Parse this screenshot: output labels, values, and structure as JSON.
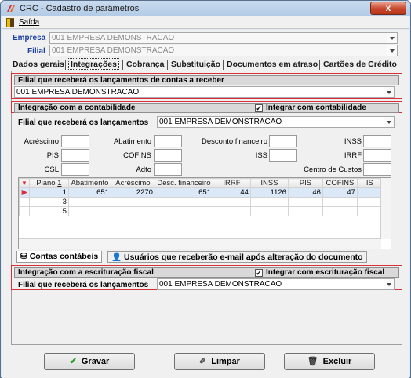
{
  "window": {
    "title": "CRC - Cadastro de parâmetros",
    "close_label": "x"
  },
  "menu": {
    "exit_label": "Saída"
  },
  "header": {
    "empresa_label": "Empresa",
    "empresa_value": "001 EMPRESA DEMONSTRACAO",
    "filial_label": "Filial",
    "filial_value": "001 EMPRESA DEMONSTRACAO"
  },
  "tabs": [
    "Dados gerais",
    "Integrações",
    "Cobrança",
    "Substituição",
    "Documentos em atraso",
    "Cartões de Crédito"
  ],
  "receivable": {
    "title": "Filial que receberá os lançamentos de contas a receber",
    "value": "001 EMPRESA DEMONSTRACAO"
  },
  "accounting": {
    "title": "Integração com a contabilidade",
    "checkbox_label": "Integrar com contabilidade",
    "checked": true,
    "filial_label": "Filial que receberá os lançamentos",
    "filial_value": "001 EMPRESA DEMONSTRACAO",
    "fields": {
      "acrescimo": "Acréscimo",
      "abatimento": "Abatimento",
      "desconto": "Desconto financeiro",
      "inss": "INSS",
      "pis": "PIS",
      "cofins": "COFINS",
      "iss": "ISS",
      "irrf": "IRRF",
      "csl": "CSL",
      "adto": "Adto",
      "centro": "Centro de Custos"
    },
    "grid": {
      "columns": [
        "Plano",
        "Abatimento",
        "Acréscimo",
        "Desc. financeiro",
        "IRRF",
        "INSS",
        "PIS",
        "COFINS",
        "IS"
      ],
      "sort_marker": "1",
      "rows": [
        [
          "1",
          "651",
          "2270",
          "651",
          "44",
          "1126",
          "46",
          "47",
          ""
        ],
        [
          "3",
          "",
          "",
          "",
          "",
          "",
          "",
          "",
          ""
        ],
        [
          "5",
          "",
          "",
          "",
          "",
          "",
          "",
          "",
          ""
        ]
      ]
    },
    "sub_tabs": [
      "Contas contábeis",
      "Usuários que receberão e-mail após alteração do documento"
    ]
  },
  "fiscal": {
    "title": "Integração com a escrituração fiscal",
    "checkbox_label": "Integrar com escrituração fiscal",
    "checked": true,
    "filial_label": "Filial que receberá os lançamentos",
    "filial_value": "001 EMPRESA DEMONSTRACAO"
  },
  "buttons": {
    "save": "Gravar",
    "clear": "Limpar",
    "delete": "Excluir"
  },
  "colors": {
    "accent_red": "#d8303a",
    "label_blue": "#1a3f9f"
  }
}
